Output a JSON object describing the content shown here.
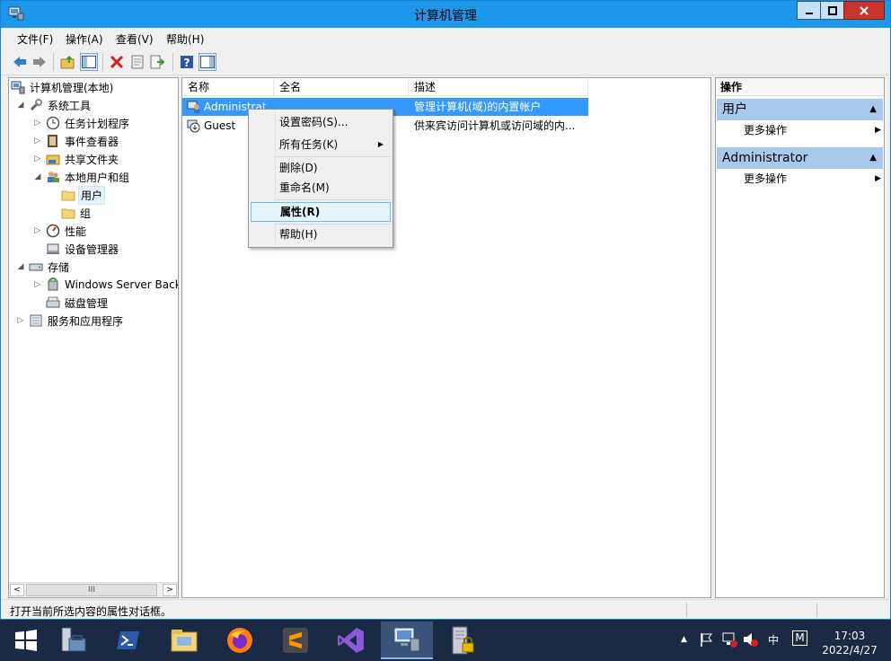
{
  "window": {
    "title": "计算机管理",
    "minimize_label": "",
    "maximize_label": "",
    "close_label": ""
  },
  "menu": [
    "文件(F)",
    "操作(A)",
    "查看(V)",
    "帮助(H)"
  ],
  "toolbar": {
    "icons": [
      "back-arrow-icon",
      "forward-arrow-icon",
      "up-folder-icon",
      "show-hide-console-tree-icon",
      "delete-icon",
      "properties-icon",
      "export-list-icon",
      "help-icon",
      "show-hide-action-pane-icon"
    ]
  },
  "tree": {
    "items": [
      {
        "label": "计算机管理(本地)",
        "expander": "",
        "icon": "computer-management-icon"
      },
      {
        "label": "系统工具",
        "expander": "◢",
        "icon": "tools-icon"
      },
      {
        "label": "任务计划程序",
        "expander": "▷",
        "icon": "clock-icon"
      },
      {
        "label": "事件查看器",
        "expander": "▷",
        "icon": "event-viewer-icon"
      },
      {
        "label": "共享文件夹",
        "expander": "▷",
        "icon": "shared-folder-icon"
      },
      {
        "label": "本地用户和组",
        "expander": "◢",
        "icon": "users-groups-icon"
      },
      {
        "label": "用户",
        "expander": "",
        "icon": "folder-icon"
      },
      {
        "label": "组",
        "expander": "",
        "icon": "folder-icon"
      },
      {
        "label": "性能",
        "expander": "▷",
        "icon": "performance-icon"
      },
      {
        "label": "设备管理器",
        "expander": "",
        "icon": "device-manager-icon"
      },
      {
        "label": "存储",
        "expander": "◢",
        "icon": "storage-icon"
      },
      {
        "label": "Windows Server Back",
        "expander": "▷",
        "icon": "backup-icon"
      },
      {
        "label": "磁盘管理",
        "expander": "",
        "icon": "disk-icon"
      },
      {
        "label": "服务和应用程序",
        "expander": "▷",
        "icon": "services-icon"
      }
    ],
    "scroll_left": "<",
    "scroll_thumb": "III",
    "scroll_right": ">"
  },
  "list": {
    "columns": [
      "名称",
      "全名",
      "描述"
    ],
    "rows": [
      {
        "name": "Administrat...",
        "fullname": "",
        "description": "管理计算机(域)的内置帐户"
      },
      {
        "name": "Guest",
        "fullname": "",
        "description": "供来宾访问计算机或访问域的内..."
      }
    ]
  },
  "context_menu": {
    "items": [
      "设置密码(S)...",
      "所有任务(K)",
      "删除(D)",
      "重命名(M)",
      "属性(R)",
      "帮助(H)"
    ],
    "submenu_arrow": "▶"
  },
  "actions": {
    "header": "操作",
    "sections": [
      {
        "title": "用户",
        "items": [
          "更多操作"
        ]
      },
      {
        "title": "Administrator",
        "items": [
          "更多操作"
        ]
      }
    ],
    "caret": "▲",
    "item_arrow": "▶"
  },
  "status": {
    "text": "打开当前所选内容的属性对话框。"
  },
  "taskbar": {
    "apps": [
      "start-icon",
      "server-manager-icon",
      "powershell-icon",
      "file-explorer-icon",
      "firefox-icon",
      "sublime-text-icon",
      "visual-studio-icon",
      "computer-management-icon",
      "server-lock-icon"
    ],
    "tray": {
      "up_arrow": "▲",
      "ime": "中",
      "ime_mode": "M"
    },
    "clock": {
      "time": "17:03",
      "date": "2022/4/27"
    }
  },
  "colors": {
    "titlebar": "#1c97ea",
    "selection": "#3399ff",
    "action_section": "#a8c9ec",
    "taskbar": "#1a2a44",
    "close_button": "#c7352c"
  }
}
